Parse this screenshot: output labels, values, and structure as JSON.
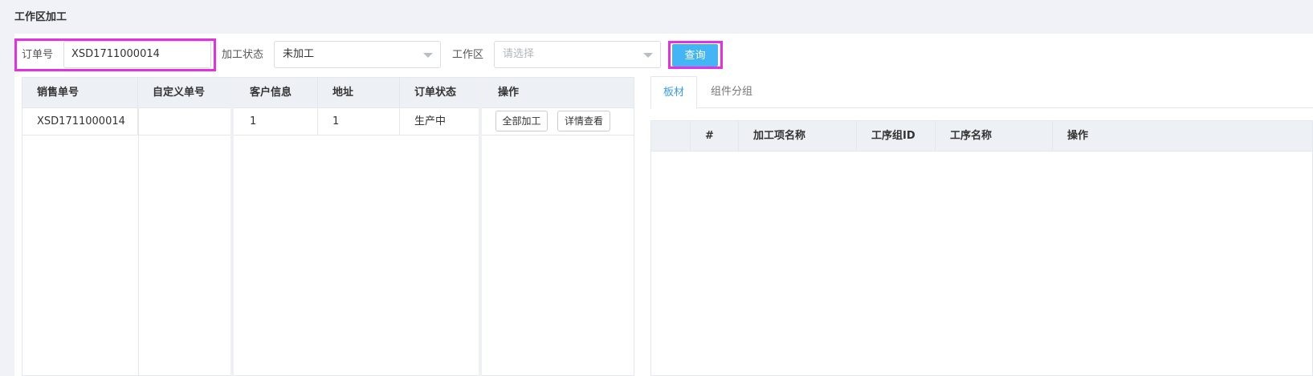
{
  "page": {
    "title": "工作区加工"
  },
  "filters": {
    "order_no": {
      "label": "订单号",
      "value": "XSD1711000014"
    },
    "process_status": {
      "label": "加工状态",
      "value": "未加工"
    },
    "workarea": {
      "label": "工作区",
      "placeholder": "请选择"
    },
    "query_label": "查询"
  },
  "orders_table": {
    "columns": [
      "销售单号",
      "自定义单号",
      "客户信息",
      "地址",
      "订单状态",
      "操作"
    ],
    "rows": [
      {
        "sales_no": "XSD1711000014",
        "custom_no": "",
        "customer": "1",
        "address": "1",
        "status": "生产中"
      }
    ],
    "actions": {
      "process_all": "全部加工",
      "view_detail": "详情查看"
    }
  },
  "tabs": [
    "板材",
    "组件分组"
  ],
  "detail_table": {
    "columns": [
      "",
      "#",
      "加工项名称",
      "工序组ID",
      "工序名称",
      "操作"
    ]
  },
  "colors": {
    "accent": "#43b4f4",
    "highlight": "#e52fe0",
    "tab_active": "#3a9be8"
  }
}
